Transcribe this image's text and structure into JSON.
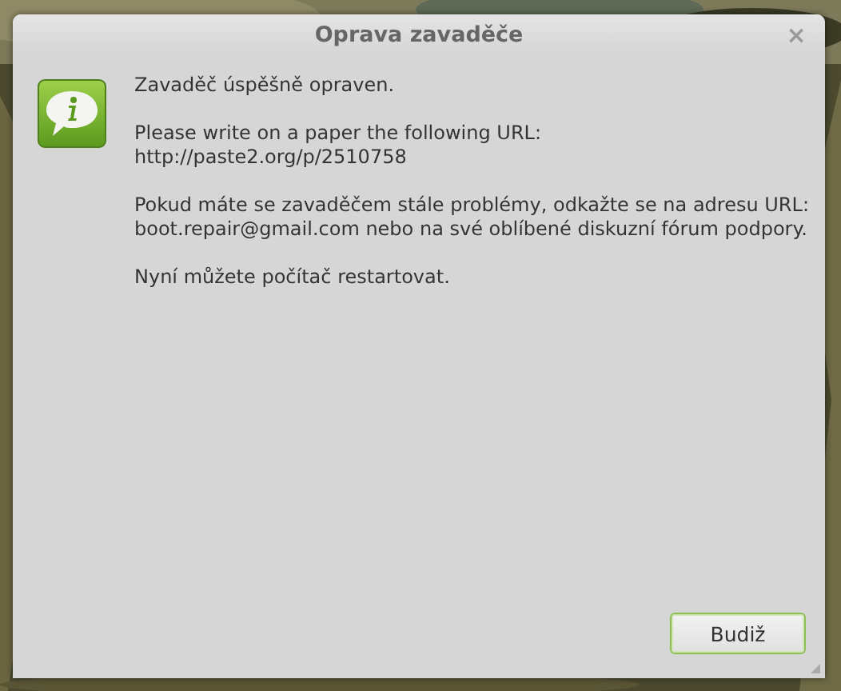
{
  "window": {
    "title": "Oprava zavaděče",
    "close": "×"
  },
  "message": {
    "paragraphs": [
      "Zavaděč úspěšně opraven.",
      "Please write on a paper the following URL:\nhttp://paste2.org/p/2510758",
      "Pokud máte se zavaděčem stále problémy, odkažte se na adresu URL:\nboot.repair@gmail.com nebo na své oblíbené diskuzní fórum podpory.",
      "Nyní můžete počítač restartovat."
    ]
  },
  "buttons": [
    {
      "label": "Budiž",
      "default": true
    }
  ]
}
